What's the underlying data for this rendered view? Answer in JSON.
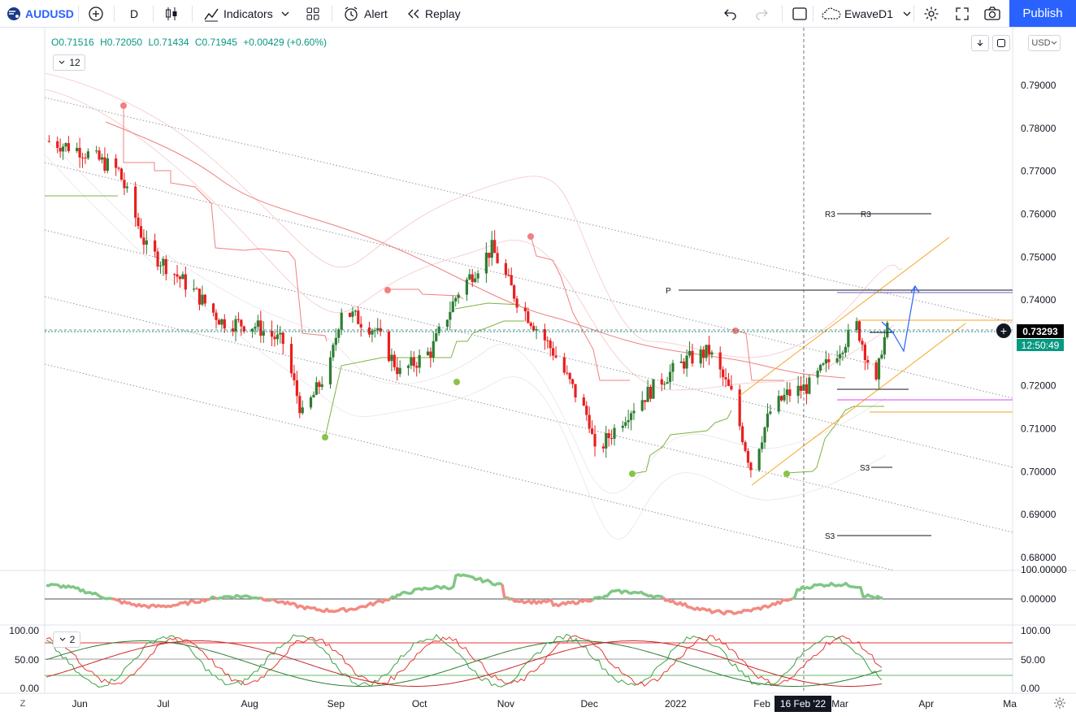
{
  "toolbar": {
    "symbol": "AUDUSD",
    "interval": "D",
    "indicators_label": "Indicators",
    "alert_label": "Alert",
    "replay_label": "Replay",
    "layout_name": "EwaveD1",
    "publish_label": "Publish"
  },
  "legend": {
    "open": "O0.71516",
    "high": "H0.72050",
    "low": "L0.71434",
    "close": "C0.71945",
    "change": "+0.00429 (+0.60%)",
    "collapsed_count_main": "12",
    "collapsed_count_osc": "2"
  },
  "currency": "USD",
  "price_tag": "0.73293",
  "countdown": "12:50:49",
  "crosshair_date": "16 Feb '22",
  "price_ticks": [
    "0.79000",
    "0.78000",
    "0.77000",
    "0.76000",
    "0.75000",
    "0.74000",
    "0.73000",
    "0.72000",
    "0.71000",
    "0.70000",
    "0.69000",
    "0.68000"
  ],
  "osc1_ticks": [
    "100.00000",
    "0.00000"
  ],
  "osc2_ticks_right": [
    "100.00",
    "50.00",
    "0.00"
  ],
  "osc2_ticks_left": [
    "100.00",
    "50.00",
    "0.00"
  ],
  "time_ticks": [
    "Jun",
    "Jul",
    "Aug",
    "Sep",
    "Oct",
    "Nov",
    "Dec",
    "2022",
    "Feb",
    "Mar",
    "Apr",
    "Ma"
  ],
  "pivot_labels": {
    "r3_a": "R3",
    "r3_b": "R3",
    "p": "P",
    "s3_a": "S3",
    "s3_b": "S3"
  },
  "timezone_button": "Z",
  "colors": {
    "up": "#089981",
    "down": "#f23645",
    "accent": "#2962ff",
    "candle_up": "#2e7d32",
    "candle_down": "#e91e1e"
  },
  "chart_data": {
    "type": "candlestick",
    "symbol": "AUDUSD",
    "interval": "D",
    "ylim": [
      0.675,
      0.797
    ],
    "x_start": "2021-05-20",
    "x_end": "2022-05-02",
    "x": [
      "2021-05-21",
      "2021-06-01",
      "2021-06-15",
      "2021-06-25",
      "2021-07-02",
      "2021-07-12",
      "2021-07-22",
      "2021-08-03",
      "2021-08-13",
      "2021-08-20",
      "2021-08-30",
      "2021-09-03",
      "2021-09-15",
      "2021-09-24",
      "2021-10-05",
      "2021-10-15",
      "2021-10-27",
      "2021-11-05",
      "2021-11-18",
      "2021-12-01",
      "2021-12-03",
      "2021-12-15",
      "2021-12-28",
      "2022-01-05",
      "2022-01-13",
      "2022-01-21",
      "2022-01-28",
      "2022-02-04",
      "2022-02-10",
      "2022-02-18",
      "2022-02-28",
      "2022-03-07",
      "2022-03-14",
      "2022-03-16",
      "2022-03-18"
    ],
    "y": [
      0.777,
      0.775,
      0.77,
      0.752,
      0.748,
      0.742,
      0.735,
      0.734,
      0.73,
      0.713,
      0.725,
      0.738,
      0.733,
      0.723,
      0.728,
      0.742,
      0.752,
      0.74,
      0.728,
      0.712,
      0.704,
      0.714,
      0.722,
      0.726,
      0.728,
      0.718,
      0.701,
      0.714,
      0.718,
      0.72,
      0.728,
      0.734,
      0.72,
      0.729,
      0.733
    ],
    "pivots": {
      "R3": [
        0.76
      ],
      "P": [
        0.7425
      ],
      "S3": [
        0.7012,
        0.685
      ]
    },
    "oscillator_1": {
      "ticks": [
        100,
        0
      ]
    },
    "oscillator_2": {
      "ticks": [
        100,
        50,
        0
      ]
    }
  }
}
